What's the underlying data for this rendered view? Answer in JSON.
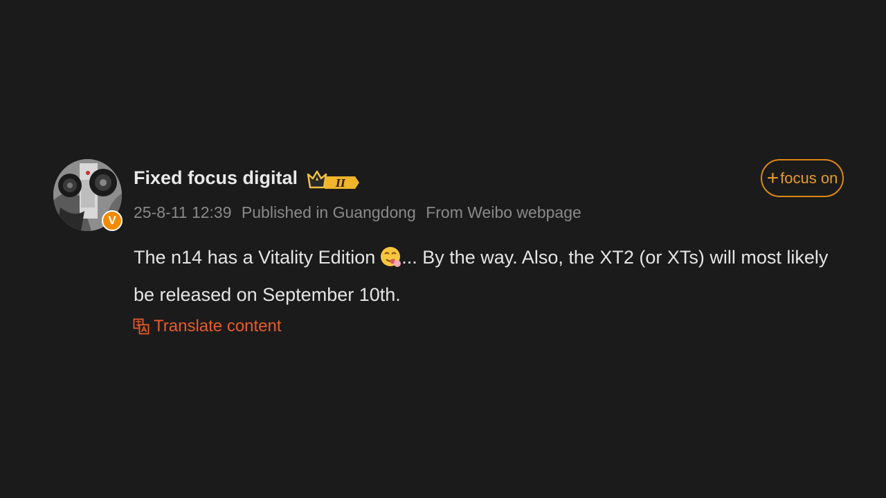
{
  "post": {
    "author": {
      "name": "Fixed focus digital",
      "verified_badge": "V",
      "avatar_icon": "camera-avatar",
      "level_badge": "II",
      "level_icon": "crown-level-icon"
    },
    "meta": {
      "timestamp": "25-8-11 12:39",
      "location": "Published in Guangdong",
      "source": "From Weibo webpage"
    },
    "content": {
      "text_part1": "The n14 has a Vitality Edition",
      "emoji_icon": "savoring-emoji",
      "text_part2": "...  By the way.  Also, the XT2 (or XTs) will most likely be released on September 10th."
    },
    "translate_label": "Translate content",
    "follow_button": {
      "plus": "+",
      "label": "focus on"
    }
  },
  "colors": {
    "background": "#1b1b1b",
    "accent_orange": "#e08814",
    "translate_red": "#e85b2a",
    "meta_gray": "#8a8a8a"
  }
}
